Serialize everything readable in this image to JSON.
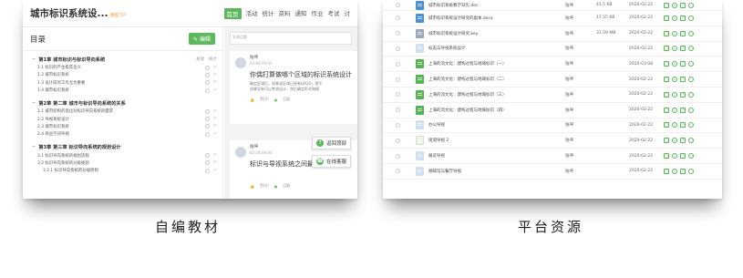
{
  "left": {
    "header": {
      "title": "城市标识系统设...",
      "subtitle": "课程门户",
      "nav": [
        "首页",
        "活动",
        "统计",
        "资料",
        "通知",
        "作业",
        "考试",
        "讨"
      ]
    },
    "toc": {
      "title": "目录",
      "edit_label": "编辑",
      "chapters": [
        {
          "title": "第1章 城市标识与标识导向系统",
          "meta": [
            "发放",
            "统计"
          ],
          "items": [
            "1.1 标识的产生极其含义",
            "1.2 城市标识系统",
            "1.3 设计前的工作尤为重要",
            "1.4 城市标识系统"
          ]
        },
        {
          "title": "第2章 第二章 城市与标识导向系统的关系",
          "meta": [],
          "items": [
            "2.1 城市结构的变化对标识导向系统的需求",
            "2.2 导视系统设计",
            "2.3 城市标识系统",
            "2.4 商业空间导视"
          ]
        },
        {
          "title": "第3章 第三章 标识导向系统的规划设计",
          "meta": [],
          "items": [
            "3.1 标识导向系统的规划流程",
            "3.2 标识导向系统的分级规划",
            "3.2.1 标识导向系统的分级原则"
          ]
        }
      ]
    },
    "discussion": {
      "input_placeholder": "发表话题",
      "posts": [
        {
          "author": "陆坤",
          "date": "04-08 09:03",
          "title": "你偶打算做哪个区域的标识系统设计",
          "body": [
            "确定区域后，如果该区域已经有LOGO，就不",
            "如果没有可以考虑设计，然后确定形式和规"
          ],
          "likes": "赞(0)",
          "reply": "回复"
        },
        {
          "author": "陆坤",
          "date": "02-28 09:44",
          "title": "标识与导视系统之间最重要的关系",
          "likes": "赞(0)",
          "reply": "回复"
        }
      ],
      "back_top": "返回顶部",
      "online_service": "在线客服"
    }
  },
  "right": {
    "files": [
      {
        "name": "城市标识系统教学日历.doc",
        "type": "doc",
        "owner": "陆坤",
        "size": "41.5 KB",
        "date": "2020-02-22"
      },
      {
        "name": "城市标识系统设计研究的副本.docx",
        "type": "doc",
        "owner": "陆坤",
        "size": "17.55 KB",
        "date": "2020-02-22"
      },
      {
        "name": "城市标识系统设计研究.key",
        "type": "key",
        "owner": "陆坤",
        "size": "31.09 MB",
        "date": "2020-02-22"
      },
      {
        "name": "标志与导视系统设计",
        "type": "blank",
        "owner": "陆坤",
        "size": "",
        "date": "2020-02-22"
      },
      {
        "name": "上海的流文化：建构过程与地域标识（一）",
        "type": "ppt",
        "owner": "陆坤",
        "size": "",
        "date": "2020-03-08"
      },
      {
        "name": "上海的流文化：建构过程与地域标识（二）",
        "type": "ppt",
        "owner": "陆坤",
        "size": "",
        "date": "2020-02-22"
      },
      {
        "name": "上海的流文化：建构过程与地域标识（三）",
        "type": "ppt",
        "owner": "陆坤",
        "size": "",
        "date": "2020-02-22"
      },
      {
        "name": "上海的流文化：建构过程与地域标识（四）",
        "type": "ppt",
        "owner": "陆坤",
        "size": "",
        "date": "2020-02-22"
      },
      {
        "name": "办公导视",
        "type": "blank",
        "owner": "陆坤",
        "size": "",
        "date": "2020-02-22"
      },
      {
        "name": "街道导视 2",
        "type": "page",
        "owner": "陆坤",
        "size": "",
        "date": "2020-02-22"
      },
      {
        "name": "展览导视",
        "type": "blank",
        "owner": "陆坤",
        "size": "",
        "date": "2020-02-22"
      },
      {
        "name": "咖啡馆与餐厅导视",
        "type": "blank",
        "owner": "陆坤",
        "size": "",
        "date": "2020-02-22"
      }
    ]
  },
  "captions": {
    "left": "自编教材",
    "right": "平台资源"
  },
  "colors": {
    "accent": "#5cb85c",
    "brand_sub": "#ff8c1a"
  }
}
